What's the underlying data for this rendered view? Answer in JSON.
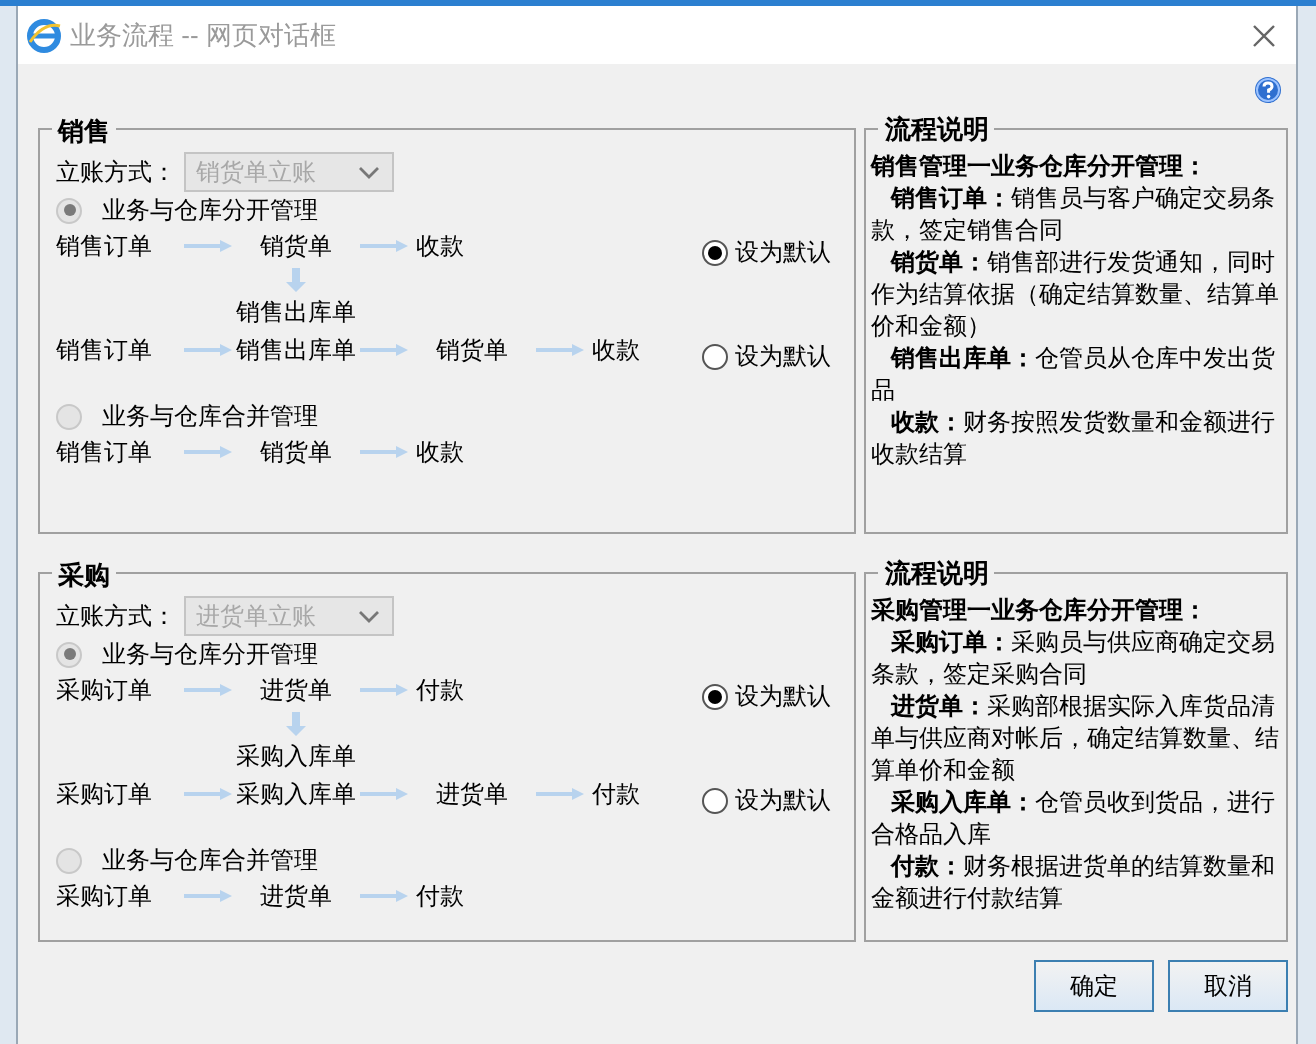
{
  "window": {
    "title": "业务流程 -- 网页对话框"
  },
  "sections": [
    {
      "title": "销售",
      "method_label": "立账方式：",
      "method_value": "销货单立账",
      "modes": [
        {
          "label": "业务与仓库分开管理",
          "selected": true,
          "flows": [
            {
              "steps": [
                "销售订单",
                "销货单",
                "收款"
              ],
              "branch": "销售出库单",
              "default": {
                "label": "设为默认",
                "selected": true
              }
            },
            {
              "steps": [
                "销售订单",
                "销售出库单",
                "销货单",
                "收款"
              ],
              "default": {
                "label": "设为默认",
                "selected": false
              }
            }
          ]
        },
        {
          "label": "业务与仓库合并管理",
          "selected": false,
          "flows": [
            {
              "steps": [
                "销售订单",
                "销货单",
                "收款"
              ]
            }
          ]
        }
      ],
      "explanation": {
        "title": "流程说明",
        "heading": "销售管理一业务仓库分开管理：",
        "items": [
          "**销售订单：**销售员与客户确定交易条款，签定销售合同",
          "**销货单：**销售部进行发货通知，同时作为结算依据（确定结算数量、结算单价和金额）",
          "**销售出库单：**仓管员从仓库中发出货品",
          "**收款：**财务按照发货数量和金额进行收款结算"
        ]
      }
    },
    {
      "title": "采购",
      "method_label": "立账方式：",
      "method_value": "进货单立账",
      "modes": [
        {
          "label": "业务与仓库分开管理",
          "selected": true,
          "flows": [
            {
              "steps": [
                "采购订单",
                "进货单",
                "付款"
              ],
              "branch": "采购入库单",
              "default": {
                "label": "设为默认",
                "selected": true
              }
            },
            {
              "steps": [
                "采购订单",
                "采购入库单",
                "进货单",
                "付款"
              ],
              "default": {
                "label": "设为默认",
                "selected": false
              }
            }
          ]
        },
        {
          "label": "业务与仓库合并管理",
          "selected": false,
          "flows": [
            {
              "steps": [
                "采购订单",
                "进货单",
                "付款"
              ]
            }
          ]
        }
      ],
      "explanation": {
        "title": "流程说明",
        "heading": "采购管理一业务仓库分开管理：",
        "items": [
          "**采购订单：**采购员与供应商确定交易条款，签定采购合同",
          "**进货单：**采购部根据实际入库货品清单与供应商对帐后，确定结算数量、结算单价和金额",
          "**采购入库单：**仓管员收到货品，进行合格品入库",
          "**付款：**财务根据进货单的结算数量和金额进行付款结算"
        ]
      }
    }
  ],
  "buttons": [
    "确定",
    "取消"
  ]
}
